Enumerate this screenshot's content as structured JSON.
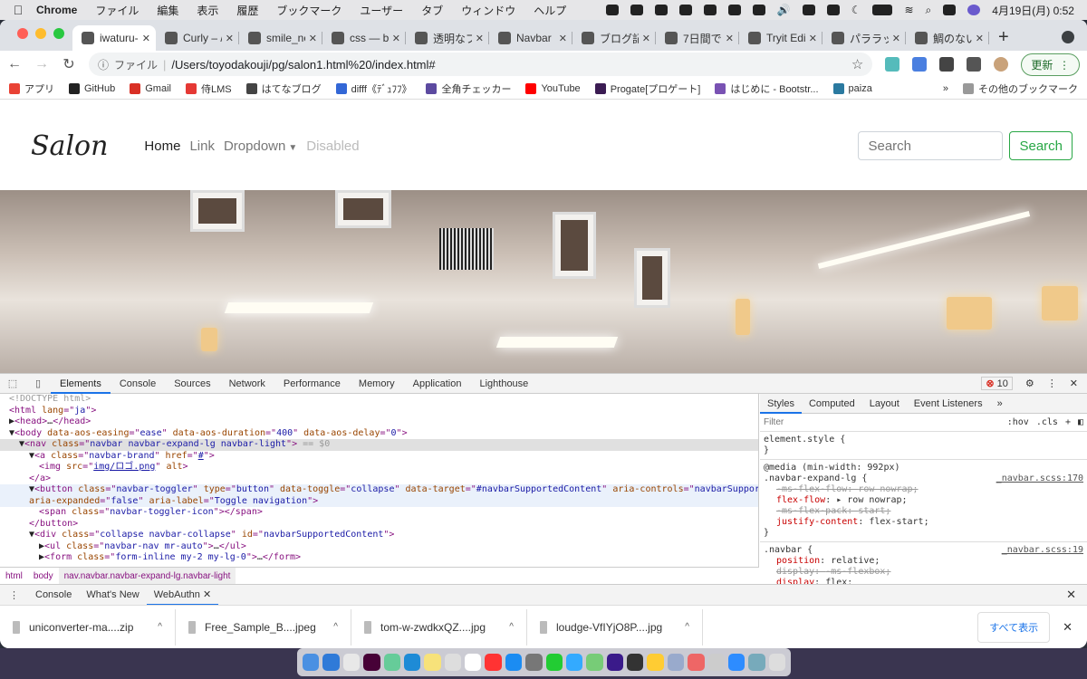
{
  "menubar": {
    "app": "Chrome",
    "items": [
      "ファイル",
      "編集",
      "表示",
      "履歴",
      "ブックマーク",
      "ユーザー",
      "タブ",
      "ウィンドウ",
      "ヘルプ"
    ],
    "clock": "4月19日(月)  0:52"
  },
  "tabs": [
    {
      "title": "iwaturu-",
      "active": true,
      "icon": "globe-icon"
    },
    {
      "title": "Curly – /",
      "icon": "page-icon"
    },
    {
      "title": "smile_nc",
      "icon": "globe-icon"
    },
    {
      "title": "css — bo",
      "icon": "terminal-icon"
    },
    {
      "title": "透明なブ",
      "icon": "image-icon"
    },
    {
      "title": "Navbar",
      "icon": "bootstrap-icon"
    },
    {
      "title": "ブログ記",
      "icon": "hatena-icon"
    },
    {
      "title": "7日間で",
      "icon": "amazon-icon"
    },
    {
      "title": "Tryit Edi",
      "icon": "w3-icon"
    },
    {
      "title": "パララッ",
      "icon": "site-icon"
    },
    {
      "title": "鯛のない",
      "icon": "dyc-icon"
    }
  ],
  "toolbar": {
    "scheme": "ファイル",
    "url": "/Users/toyodakouji/pg/salon1.html%20/index.html#",
    "update": "更新"
  },
  "bookmarks": [
    {
      "label": "アプリ",
      "color": "#e94235"
    },
    {
      "label": "GitHub",
      "color": "#222"
    },
    {
      "label": "Gmail",
      "color": "#d93025"
    },
    {
      "label": "侍LMS",
      "color": "#e53935"
    },
    {
      "label": "はてなブログ",
      "color": "#444"
    },
    {
      "label": "difff《ﾃﾞｭﾌﾌ》",
      "color": "#3367d6"
    },
    {
      "label": "全角チェッカー",
      "color": "#5c4aa0"
    },
    {
      "label": "YouTube",
      "color": "#ff0000"
    },
    {
      "label": "Progate[プロゲート]",
      "color": "#3b1c53"
    },
    {
      "label": "はじめに - Bootstr...",
      "color": "#7952b3"
    },
    {
      "label": "paiza",
      "color": "#2b7aa0"
    }
  ],
  "bookmarks_more": "»",
  "bookmarks_other": "その他のブックマーク",
  "site": {
    "brand": "Salon",
    "nav": [
      "Home",
      "Link",
      "Dropdown",
      "Disabled"
    ],
    "search_placeholder": "Search",
    "search_button": "Search",
    "accent": "#28a745"
  },
  "devtools": {
    "tabs": [
      "Elements",
      "Console",
      "Sources",
      "Network",
      "Performance",
      "Memory",
      "Application",
      "Lighthouse"
    ],
    "active": "Elements",
    "errors": "10",
    "dom": [
      {
        "i": 0,
        "t": [
          [
            "dim",
            "<!DOCTYPE html>"
          ]
        ]
      },
      {
        "i": 0,
        "t": [
          [
            "tag",
            "<html "
          ],
          [
            "attr",
            "lang"
          ],
          [
            "tag",
            "=\""
          ],
          [
            "val",
            "ja"
          ],
          [
            "tag",
            "\">"
          ]
        ]
      },
      {
        "i": 0,
        "t": [
          [
            "txt",
            "▶"
          ],
          [
            "tag",
            "<head>"
          ],
          [
            "txt",
            "…"
          ],
          [
            "tag",
            "</head>"
          ]
        ]
      },
      {
        "i": 0,
        "t": [
          [
            "txt",
            "▼"
          ],
          [
            "tag",
            "<body "
          ],
          [
            "attr",
            "data-aos-easing"
          ],
          [
            "tag",
            "=\""
          ],
          [
            "val",
            "ease"
          ],
          [
            "tag",
            "\" "
          ],
          [
            "attr",
            "data-aos-duration"
          ],
          [
            "tag",
            "=\""
          ],
          [
            "val",
            "400"
          ],
          [
            "tag",
            "\" "
          ],
          [
            "attr",
            "data-aos-delay"
          ],
          [
            "tag",
            "=\""
          ],
          [
            "val",
            "0"
          ],
          [
            "tag",
            "\">"
          ]
        ]
      },
      {
        "i": 1,
        "sel": true,
        "t": [
          [
            "txt",
            "▼"
          ],
          [
            "tag",
            "<nav "
          ],
          [
            "attr",
            "class"
          ],
          [
            "tag",
            "=\""
          ],
          [
            "val",
            "navbar navbar-expand-lg navbar-light"
          ],
          [
            "tag",
            "\">"
          ],
          [
            "dim",
            " == $0"
          ]
        ]
      },
      {
        "i": 2,
        "t": [
          [
            "txt",
            "▼"
          ],
          [
            "tag",
            "<a "
          ],
          [
            "attr",
            "class"
          ],
          [
            "tag",
            "=\""
          ],
          [
            "val",
            "navbar-brand"
          ],
          [
            "tag",
            "\" "
          ],
          [
            "attr",
            "href"
          ],
          [
            "tag",
            "=\""
          ],
          [
            "link",
            "#"
          ],
          [
            "tag",
            "\">"
          ]
        ]
      },
      {
        "i": 3,
        "t": [
          [
            "tag",
            "<img "
          ],
          [
            "attr",
            "src"
          ],
          [
            "tag",
            "=\""
          ],
          [
            "link",
            "img/ロゴ.png"
          ],
          [
            "tag",
            "\" "
          ],
          [
            "attr",
            "alt"
          ],
          [
            "tag",
            ">"
          ]
        ]
      },
      {
        "i": 2,
        "t": [
          [
            "tag",
            "</a>"
          ]
        ]
      },
      {
        "i": 2,
        "hov": true,
        "t": [
          [
            "txt",
            "▼"
          ],
          [
            "tag",
            "<button "
          ],
          [
            "attr",
            "class"
          ],
          [
            "tag",
            "=\""
          ],
          [
            "val",
            "navbar-toggler"
          ],
          [
            "tag",
            "\" "
          ],
          [
            "attr",
            "type"
          ],
          [
            "tag",
            "=\""
          ],
          [
            "val",
            "button"
          ],
          [
            "tag",
            "\" "
          ],
          [
            "attr",
            "data-toggle"
          ],
          [
            "tag",
            "=\""
          ],
          [
            "val",
            "collapse"
          ],
          [
            "tag",
            "\" "
          ],
          [
            "attr",
            "data-target"
          ],
          [
            "tag",
            "=\""
          ],
          [
            "val",
            "#navbarSupportedContent"
          ],
          [
            "tag",
            "\" "
          ],
          [
            "attr",
            "aria-controls"
          ],
          [
            "tag",
            "=\""
          ],
          [
            "val",
            "navbarSupportedContent"
          ],
          [
            "tag",
            "\""
          ]
        ]
      },
      {
        "i": 2,
        "hov": true,
        "t": [
          [
            "attr",
            "aria-expanded"
          ],
          [
            "tag",
            "=\""
          ],
          [
            "val",
            "false"
          ],
          [
            "tag",
            "\" "
          ],
          [
            "attr",
            "aria-label"
          ],
          [
            "tag",
            "=\""
          ],
          [
            "val",
            "Toggle navigation"
          ],
          [
            "tag",
            "\">"
          ]
        ]
      },
      {
        "i": 3,
        "t": [
          [
            "tag",
            "<span "
          ],
          [
            "attr",
            "class"
          ],
          [
            "tag",
            "=\""
          ],
          [
            "val",
            "navbar-toggler-icon"
          ],
          [
            "tag",
            "\"></span>"
          ]
        ]
      },
      {
        "i": 2,
        "t": [
          [
            "tag",
            "</button>"
          ]
        ]
      },
      {
        "i": 2,
        "t": [
          [
            "txt",
            "▼"
          ],
          [
            "tag",
            "<div "
          ],
          [
            "attr",
            "class"
          ],
          [
            "tag",
            "=\""
          ],
          [
            "val",
            "collapse navbar-collapse"
          ],
          [
            "tag",
            "\" "
          ],
          [
            "attr",
            "id"
          ],
          [
            "tag",
            "=\""
          ],
          [
            "val",
            "navbarSupportedContent"
          ],
          [
            "tag",
            "\">"
          ]
        ]
      },
      {
        "i": 3,
        "t": [
          [
            "txt",
            "▶"
          ],
          [
            "tag",
            "<ul "
          ],
          [
            "attr",
            "class"
          ],
          [
            "tag",
            "=\""
          ],
          [
            "val",
            "navbar-nav mr-auto"
          ],
          [
            "tag",
            "\">"
          ],
          [
            "txt",
            "…"
          ],
          [
            "tag",
            "</ul>"
          ]
        ]
      },
      {
        "i": 3,
        "t": [
          [
            "txt",
            "▶"
          ],
          [
            "tag",
            "<form "
          ],
          [
            "attr",
            "class"
          ],
          [
            "tag",
            "=\""
          ],
          [
            "val",
            "form-inline my-2 my-lg-0"
          ],
          [
            "tag",
            "\">"
          ],
          [
            "txt",
            "…"
          ],
          [
            "tag",
            "</form>"
          ]
        ]
      }
    ],
    "breadcrumbs": [
      "html",
      "body",
      "nav.navbar.navbar-expand-lg.navbar-light"
    ],
    "styles_tabs": [
      "Styles",
      "Computed",
      "Layout",
      "Event Listeners",
      "»"
    ],
    "filter_placeholder": "Filter",
    "hov": ":hov",
    "cls": ".cls",
    "plus": "+",
    "rules": [
      {
        "head": [
          "element.style {"
        ],
        "src": "",
        "props": [],
        "close": "}"
      },
      {
        "head": [
          "@media (min-width: 992px)",
          ".navbar-expand-lg {"
        ],
        "src": "_navbar.scss:170",
        "props": [
          {
            "n": "-ms-flex-flow",
            "v": "row nowrap;",
            "strike": true
          },
          {
            "n": "flex-flow",
            "v": "▸ row nowrap;"
          },
          {
            "n": "-ms-flex-pack",
            "v": "start;",
            "strike": true
          },
          {
            "n": "justify-content",
            "v": "flex-start;"
          }
        ],
        "close": "}"
      },
      {
        "head": [
          ".navbar {"
        ],
        "src": "_navbar.scss:19",
        "props": [
          {
            "n": "position",
            "v": "relative;"
          },
          {
            "n": "display",
            "v": "-ms-flexbox;",
            "strike": true
          },
          {
            "n": "display",
            "v": "flex;"
          }
        ],
        "close": ""
      }
    ],
    "drawer_tabs": [
      "Console",
      "What's New",
      "WebAuthn"
    ],
    "drawer_active": "WebAuthn"
  },
  "downloads": {
    "items": [
      "uniconverter-ma....zip",
      "Free_Sample_B....jpeg",
      "tom-w-zwdkxQZ....jpg",
      "loudge-VfIYjO8P....jpg"
    ],
    "show_all": "すべて表示"
  }
}
